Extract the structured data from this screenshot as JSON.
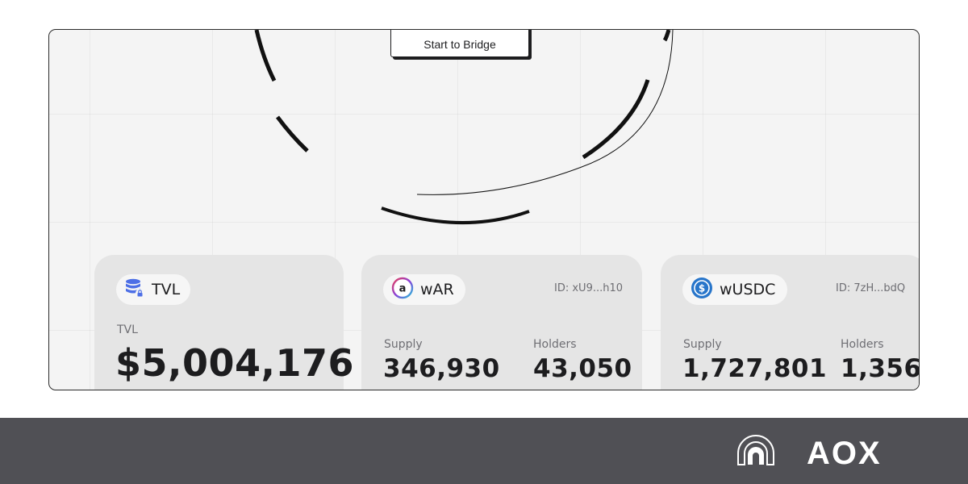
{
  "bridge": {
    "button_label": "Start to Bridge"
  },
  "cards": {
    "tvl": {
      "chip_label": "TVL",
      "label": "TVL",
      "value": "$5,004,176"
    },
    "war": {
      "chip_label": "wAR",
      "id": "ID: xU9...h10",
      "supply_label": "Supply",
      "supply": "346,930",
      "holders_label": "Holders",
      "holders": "43,050"
    },
    "wusdc": {
      "chip_label": "wUSDC",
      "id": "ID: 7zH...bdQ",
      "supply_label": "Supply",
      "supply": "1,727,801",
      "holders_label": "Holders",
      "holders": "1,356"
    }
  },
  "footer": {
    "logo_text": "AOX"
  },
  "icons": {
    "tvl": "database-lock-icon",
    "war": "arweave-logo-icon",
    "wusdc": "usdc-logo-icon",
    "brand": "aox-arch-logo-icon"
  },
  "colors": {
    "usdc_blue": "#2775ca",
    "database_blue": "#4d6fe6",
    "footer_bg": "#505055"
  }
}
